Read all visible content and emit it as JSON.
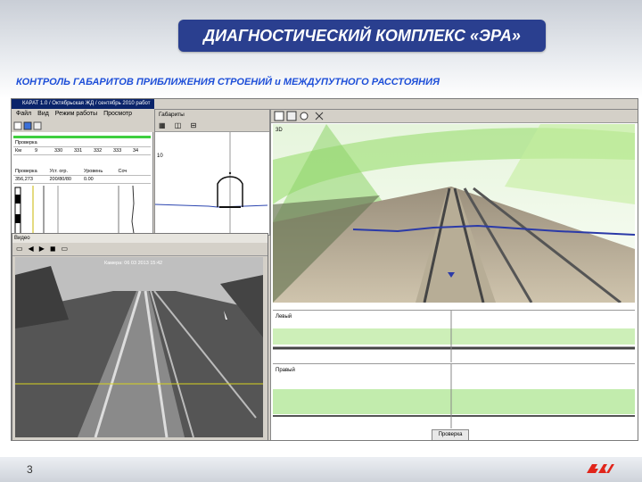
{
  "slide": {
    "title": "ДИАГНОСТИЧЕСКИЙ КОМПЛЕКС «ЭРА»",
    "subtitle": "КОНТРОЛЬ ГАБАРИТОВ ПРИБЛИЖЕНИЯ СТРОЕНИЙ и МЕЖДУПУТНОГО РАССТОЯНИЯ",
    "page_number": "3",
    "logo": "rzd-logo",
    "colors": {
      "title_bg": "#2a3f8f",
      "subtitle": "#1e4fd8",
      "logo": "#e1251b"
    }
  },
  "main_window": {
    "title": "КАРАТ 1.0 / Октябрьская ЖД / сентябрь 2010 работ",
    "menu": [
      "Файл",
      "Вид",
      "Режим работы",
      "Просмотр"
    ],
    "panel_top": {
      "label1": "Проверка",
      "label2": "Км",
      "km_values": [
        "9",
        "330",
        "331",
        "332",
        "333",
        "34"
      ]
    },
    "table_headers": [
      "Проверка",
      "Уст. огр.",
      "Уровень",
      "Соч"
    ],
    "table_row": [
      "356,273",
      "200/80/80",
      "0.00",
      ""
    ],
    "graph_ticks": [
      "1",
      "1"
    ]
  },
  "gabarity_window": {
    "title": "Габариты",
    "tick": "10"
  },
  "right_window": {
    "label_3d": "3D",
    "label_left": "Левый",
    "label_right": "Правый",
    "status": "Проверка"
  },
  "video_window": {
    "title": "Видео",
    "overlay": "Камера: 06 03 2013 15:42"
  }
}
